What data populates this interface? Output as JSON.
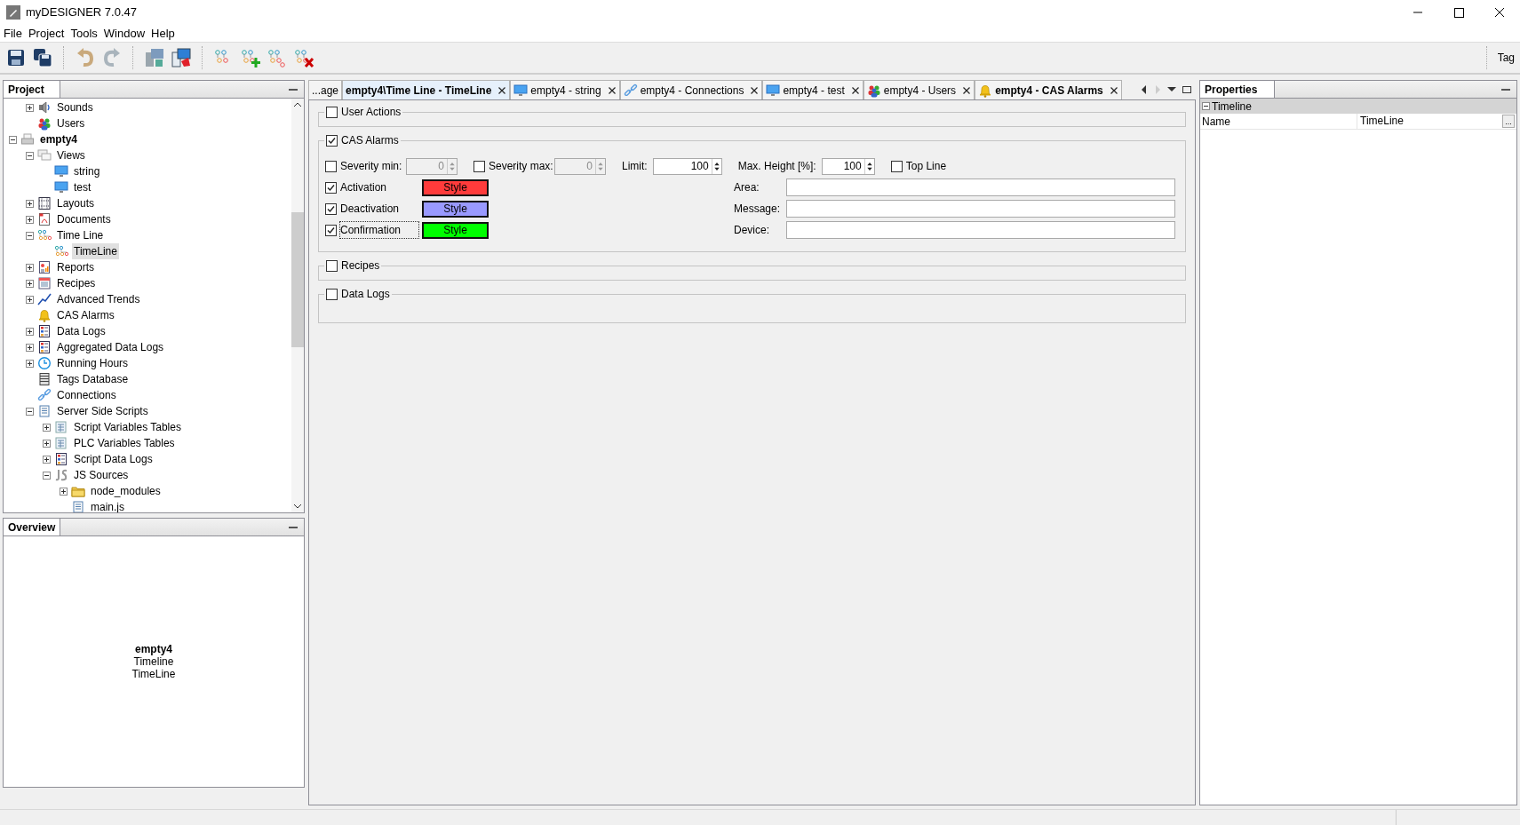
{
  "window": {
    "title": "myDESIGNER 7.0.47"
  },
  "menu": [
    "File",
    "Project",
    "Tools",
    "Window",
    "Help"
  ],
  "toolbar": {
    "right_label": "Tag"
  },
  "project_panel": {
    "title": "Project",
    "tree_partial": [
      {
        "label": "Sounds",
        "kind": "sound",
        "expanded": false,
        "selected": false
      },
      {
        "label": "Users",
        "kind": "users",
        "selected": false
      }
    ],
    "tree": [
      {
        "label": "empty4",
        "kind": "project",
        "bold": true,
        "expanded": true,
        "selected": false,
        "children": [
          {
            "label": "Views",
            "kind": "views",
            "expanded": true,
            "selected": false,
            "children": [
              {
                "label": "string",
                "kind": "screen",
                "selected": false
              },
              {
                "label": "test",
                "kind": "screen",
                "selected": false
              }
            ]
          },
          {
            "label": "Layouts",
            "kind": "layouts",
            "expanded": false,
            "selected": false
          },
          {
            "label": "Documents",
            "kind": "documents",
            "expanded": false,
            "selected": false
          },
          {
            "label": "Time Line",
            "kind": "timeline",
            "expanded": true,
            "selected": false,
            "children": [
              {
                "label": "TimeLine",
                "kind": "timeline",
                "selected": true
              }
            ]
          },
          {
            "label": "Reports",
            "kind": "reports",
            "expanded": false,
            "selected": false
          },
          {
            "label": "Recipes",
            "kind": "recipes",
            "expanded": false,
            "selected": false
          },
          {
            "label": "Advanced Trends",
            "kind": "trends",
            "expanded": false,
            "selected": false
          },
          {
            "label": "CAS Alarms",
            "kind": "alarm",
            "selected": false
          },
          {
            "label": "Data Logs",
            "kind": "datalog",
            "expanded": false,
            "selected": false
          },
          {
            "label": "Aggregated Data Logs",
            "kind": "datalog",
            "expanded": false,
            "selected": false
          },
          {
            "label": "Running Hours",
            "kind": "clock",
            "expanded": false,
            "selected": false
          },
          {
            "label": "Tags Database",
            "kind": "database",
            "selected": false
          },
          {
            "label": "Connections",
            "kind": "link",
            "selected": false
          },
          {
            "label": "Server Side Scripts",
            "kind": "script",
            "expanded": true,
            "selected": false,
            "children": [
              {
                "label": "Script Variables Tables",
                "kind": "table",
                "expanded": false,
                "selected": false
              },
              {
                "label": "PLC Variables Tables",
                "kind": "table",
                "expanded": false,
                "selected": false
              },
              {
                "label": "Script Data Logs",
                "kind": "datalog",
                "expanded": false,
                "selected": false
              },
              {
                "label": "JS Sources",
                "kind": "js",
                "expanded": true,
                "selected": false,
                "children": [
                  {
                    "label": "node_modules",
                    "kind": "folder",
                    "expanded": false,
                    "selected": false
                  },
                  {
                    "label": "main.js",
                    "kind": "script",
                    "selected": false
                  }
                ]
              }
            ]
          }
        ]
      }
    ]
  },
  "overview": {
    "title": "Overview",
    "lines": [
      {
        "text": "empty4",
        "bold": true
      },
      {
        "text": "Timeline",
        "bold": false
      },
      {
        "text": "TimeLine",
        "bold": false
      }
    ]
  },
  "editor": {
    "tabs": [
      {
        "label": "...age",
        "kind": "plain",
        "selected": false,
        "bold": false,
        "closable": false
      },
      {
        "label": "empty4\\Time Line - TimeLine",
        "kind": "plain",
        "selected": true,
        "bold": true,
        "closable": true
      },
      {
        "label": "empty4 - string",
        "kind": "screen",
        "selected": false,
        "bold": false,
        "closable": true
      },
      {
        "label": "empty4 - Connections",
        "kind": "link",
        "selected": false,
        "bold": false,
        "closable": true
      },
      {
        "label": "empty4 - test",
        "kind": "screen",
        "selected": false,
        "bold": false,
        "closable": true
      },
      {
        "label": "empty4 - Users",
        "kind": "users",
        "selected": false,
        "bold": false,
        "closable": true
      },
      {
        "label": "empty4 - CAS Alarms",
        "kind": "alarm",
        "selected": false,
        "bold": true,
        "closable": true
      }
    ],
    "sections": [
      {
        "label": "User Actions",
        "checked": false
      },
      {
        "label": "CAS Alarms",
        "checked": true,
        "alarms": {
          "filters": [
            {
              "kind": "checkspin",
              "label": "Severity min:",
              "checked": false,
              "value": "0",
              "disabled": true
            },
            {
              "kind": "checkspin",
              "label": "Severity max:",
              "checked": false,
              "value": "0",
              "disabled": true
            },
            {
              "kind": "spin",
              "label": "Limit:",
              "value": "100",
              "disabled": false
            },
            {
              "kind": "spin",
              "label": "Max. Height [%]:",
              "value": "100",
              "disabled": false
            },
            {
              "kind": "check",
              "label": "Top Line",
              "checked": false
            }
          ],
          "styles": [
            {
              "label": "Activation",
              "checked": true,
              "focused": false,
              "button": "Style",
              "color": "#ff3b3b"
            },
            {
              "label": "Deactivation",
              "checked": true,
              "focused": false,
              "button": "Style",
              "color": "#9999ff"
            },
            {
              "label": "Confirmation",
              "checked": true,
              "focused": true,
              "button": "Style",
              "color": "#00ff00"
            }
          ],
          "fields": [
            {
              "label": "Area:"
            },
            {
              "label": "Message:"
            },
            {
              "label": "Device:"
            }
          ]
        }
      },
      {
        "label": "Recipes",
        "checked": false
      },
      {
        "label": "Data Logs",
        "checked": false
      }
    ]
  },
  "properties": {
    "title": "Properties",
    "groups": [
      {
        "label": "Timeline",
        "expanded": true,
        "rows": [
          {
            "name": "Name",
            "value": "TimeLine",
            "button": "..."
          }
        ]
      }
    ]
  }
}
